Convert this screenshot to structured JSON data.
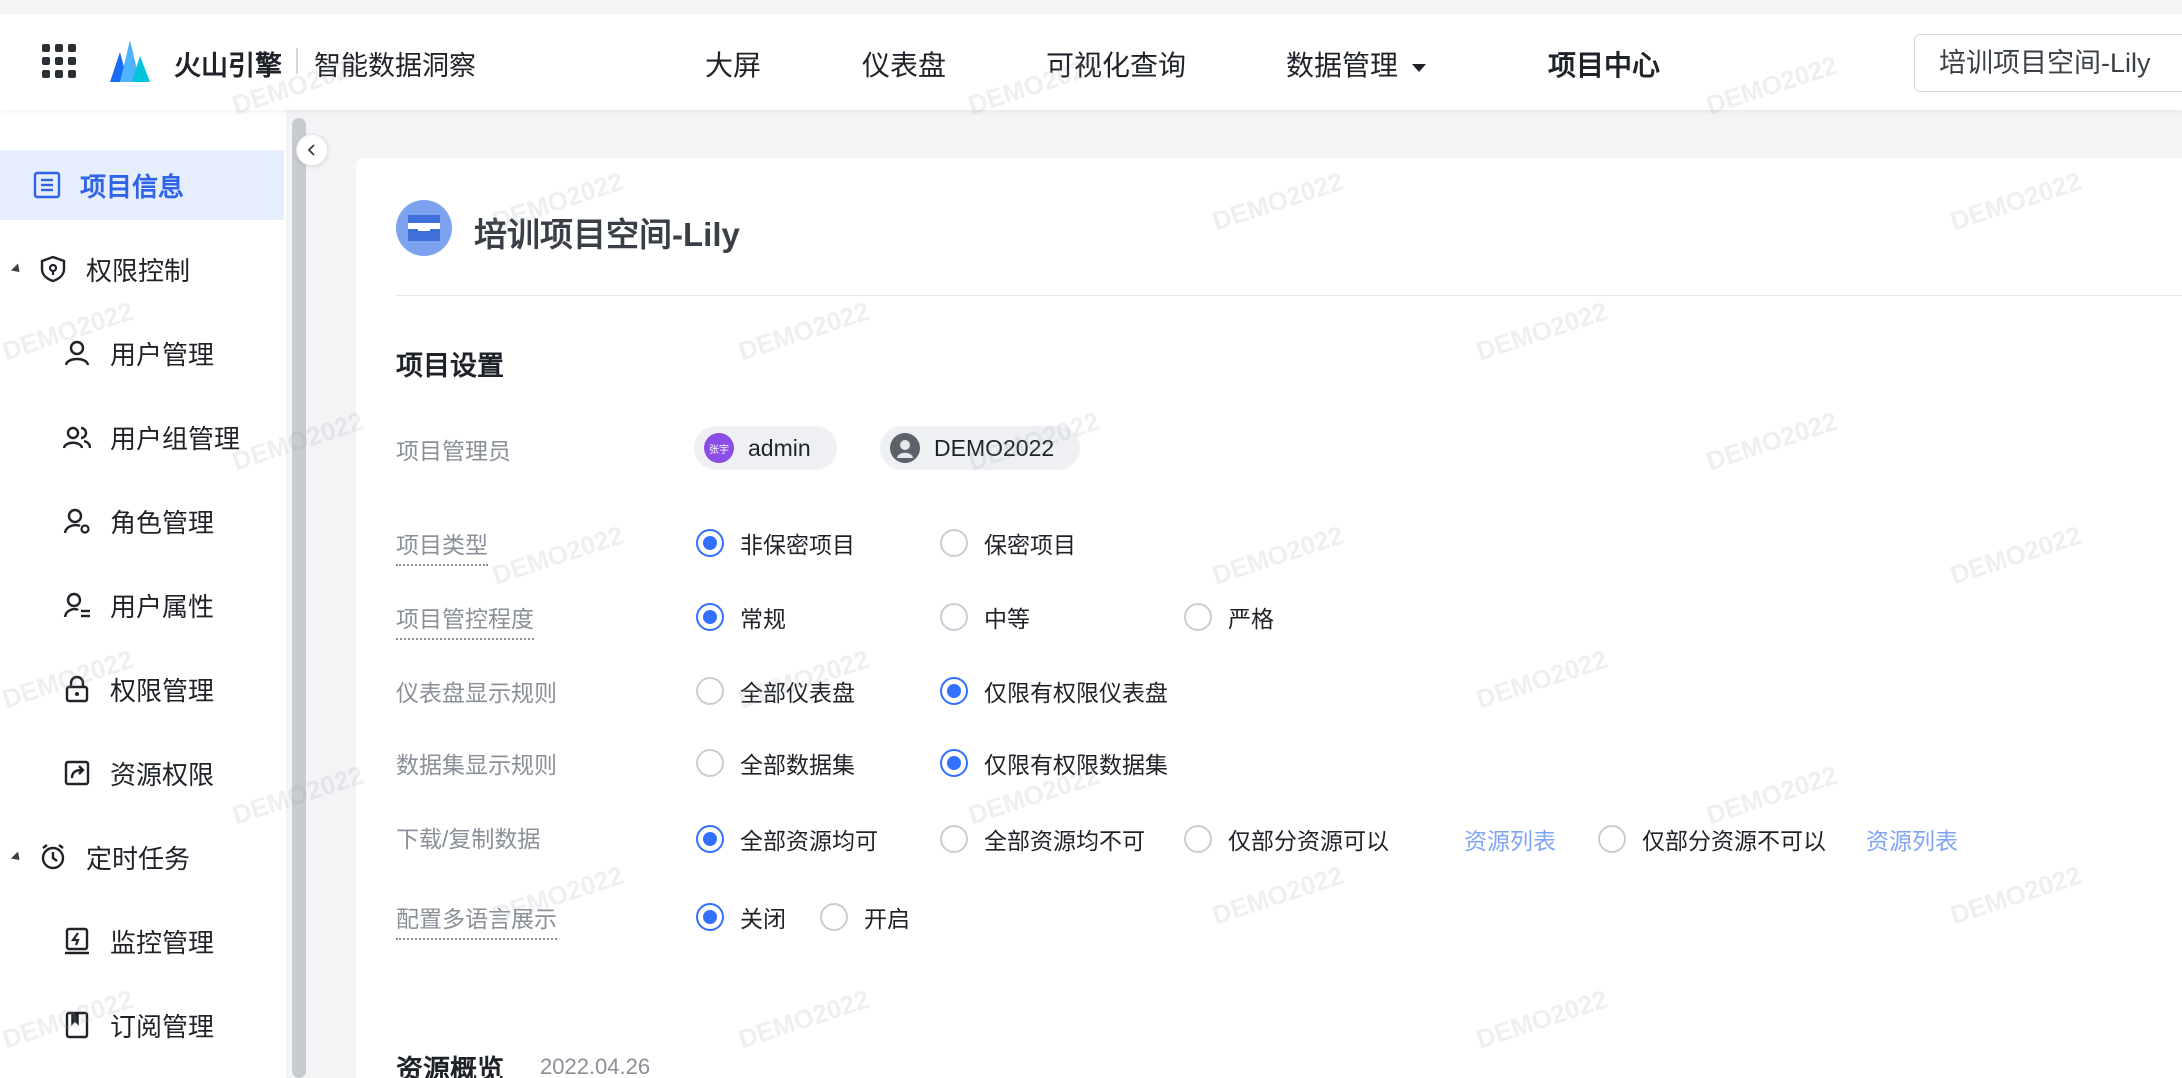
{
  "header": {
    "brand": "火山引擎",
    "product": "智能数据洞察",
    "nav": [
      {
        "label": "大屏"
      },
      {
        "label": "仪表盘"
      },
      {
        "label": "可视化查询"
      },
      {
        "label": "数据管理"
      },
      {
        "label": "项目中心"
      }
    ],
    "project_select": "培训项目空间-Lily"
  },
  "sidebar": {
    "items": [
      {
        "label": "项目信息",
        "icon": "list-icon"
      },
      {
        "label": "权限控制",
        "icon": "shield-icon"
      },
      {
        "label": "用户管理",
        "icon": "user-icon"
      },
      {
        "label": "用户组管理",
        "icon": "user-group-icon"
      },
      {
        "label": "角色管理",
        "icon": "user-settings-icon"
      },
      {
        "label": "用户属性",
        "icon": "user-attribute-icon"
      },
      {
        "label": "权限管理",
        "icon": "lock-icon"
      },
      {
        "label": "资源权限",
        "icon": "share-icon"
      },
      {
        "label": "定时任务",
        "icon": "clock-icon"
      },
      {
        "label": "监控管理",
        "icon": "monitor-icon"
      },
      {
        "label": "订阅管理",
        "icon": "bookmark-icon"
      }
    ]
  },
  "project": {
    "title": "培训项目空间-Lily",
    "settings_title": "项目设置",
    "rows": {
      "admin": {
        "label": "项目管理员",
        "users": [
          {
            "name": "admin",
            "avatar_text": "张宇"
          },
          {
            "name": "DEMO2022",
            "avatar_text": ""
          }
        ]
      },
      "type": {
        "label": "项目类型",
        "options": [
          "非保密项目",
          "保密项目"
        ],
        "selected": 0
      },
      "control": {
        "label": "项目管控程度",
        "options": [
          "常规",
          "中等",
          "严格"
        ],
        "selected": 0
      },
      "dashboard_rule": {
        "label": "仪表盘显示规则",
        "options": [
          "全部仪表盘",
          "仅限有权限仪表盘"
        ],
        "selected": 1
      },
      "dataset_rule": {
        "label": "数据集显示规则",
        "options": [
          "全部数据集",
          "仅限有权限数据集"
        ],
        "selected": 1
      },
      "download": {
        "label": "下载/复制数据",
        "options": [
          "全部资源均可",
          "全部资源均不可",
          "仅部分资源可以",
          "仅部分资源不可以"
        ],
        "selected": 0,
        "resource_link": "资源列表"
      },
      "multilang": {
        "label": "配置多语言展示",
        "options": [
          "关闭",
          "开启"
        ],
        "selected": 0
      }
    },
    "overview_title": "资源概览",
    "overview_date": "2022.04.26"
  },
  "watermark": "DEMO2022",
  "colors": {
    "accent": "#3370ff",
    "link": "#7ea4f3",
    "active_bg": "#e6edfd"
  }
}
